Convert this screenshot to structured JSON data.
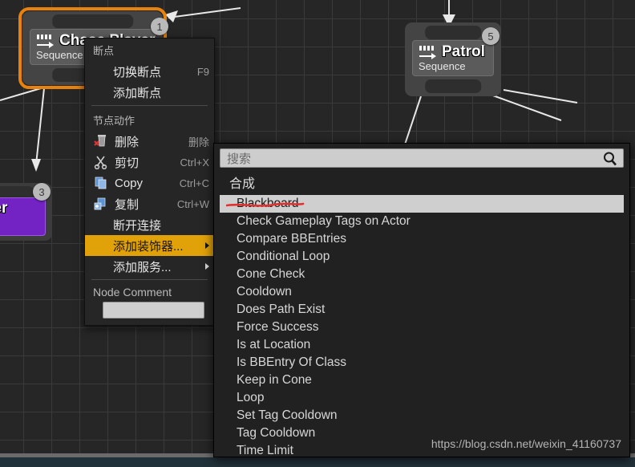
{
  "canvas": {
    "nodes": [
      {
        "name": "Chase Player",
        "subtitle": "Sequence",
        "index": "1",
        "icon": "sequence-icon",
        "selected": true
      },
      {
        "name": "Patrol",
        "subtitle": "Sequence",
        "index": "5",
        "icon": "sequence-icon",
        "selected": false
      },
      {
        "name": "layer",
        "subtitle": "",
        "index": "3",
        "icon": "task-icon",
        "selected": false
      }
    ]
  },
  "context_menu": {
    "sections": [
      {
        "title": "断点"
      },
      {
        "title": "节点动作"
      }
    ],
    "breakpoint_items": [
      {
        "label": "切换断点",
        "shortcut": "F9"
      },
      {
        "label": "添加断点",
        "shortcut": ""
      }
    ],
    "node_action_items": [
      {
        "label": "删除",
        "shortcut": "删除",
        "icon": "delete-icon"
      },
      {
        "label": "剪切",
        "shortcut": "Ctrl+X",
        "icon": "cut-icon"
      },
      {
        "label": "Copy",
        "shortcut": "Ctrl+C",
        "icon": "copy-icon"
      },
      {
        "label": "复制",
        "shortcut": "Ctrl+W",
        "icon": "duplicate-icon"
      }
    ],
    "plain_items": [
      {
        "label": "断开连接",
        "submenu": false,
        "highlighted": false
      },
      {
        "label": "添加装饰器...",
        "submenu": true,
        "highlighted": true
      },
      {
        "label": "添加服务...",
        "submenu": true,
        "highlighted": false
      }
    ],
    "node_comment_label": "Node Comment",
    "node_comment_value": ""
  },
  "search_panel": {
    "search_placeholder": "搜索",
    "search_value": "",
    "search_icon": "magnifier-icon",
    "category_label": "合成",
    "results": [
      {
        "label": "Blackboard",
        "selected": true
      },
      {
        "label": "Check Gameplay Tags on Actor",
        "selected": false
      },
      {
        "label": "Compare BBEntries",
        "selected": false
      },
      {
        "label": "Conditional Loop",
        "selected": false
      },
      {
        "label": "Cone Check",
        "selected": false
      },
      {
        "label": "Cooldown",
        "selected": false
      },
      {
        "label": "Does Path Exist",
        "selected": false
      },
      {
        "label": "Force Success",
        "selected": false
      },
      {
        "label": "Is at Location",
        "selected": false
      },
      {
        "label": "Is BBEntry Of Class",
        "selected": false
      },
      {
        "label": "Keep in Cone",
        "selected": false
      },
      {
        "label": "Loop",
        "selected": false
      },
      {
        "label": "Set Tag Cooldown",
        "selected": false
      },
      {
        "label": "Tag Cooldown",
        "selected": false
      },
      {
        "label": "Time Limit",
        "selected": false
      }
    ]
  },
  "watermark": "https://blog.csdn.net/weixin_41160737",
  "colors": {
    "highlight": "#e0a109",
    "selection_border": "#e8820c",
    "task_purple": "#7322c4",
    "annotation_red": "#e03030"
  }
}
